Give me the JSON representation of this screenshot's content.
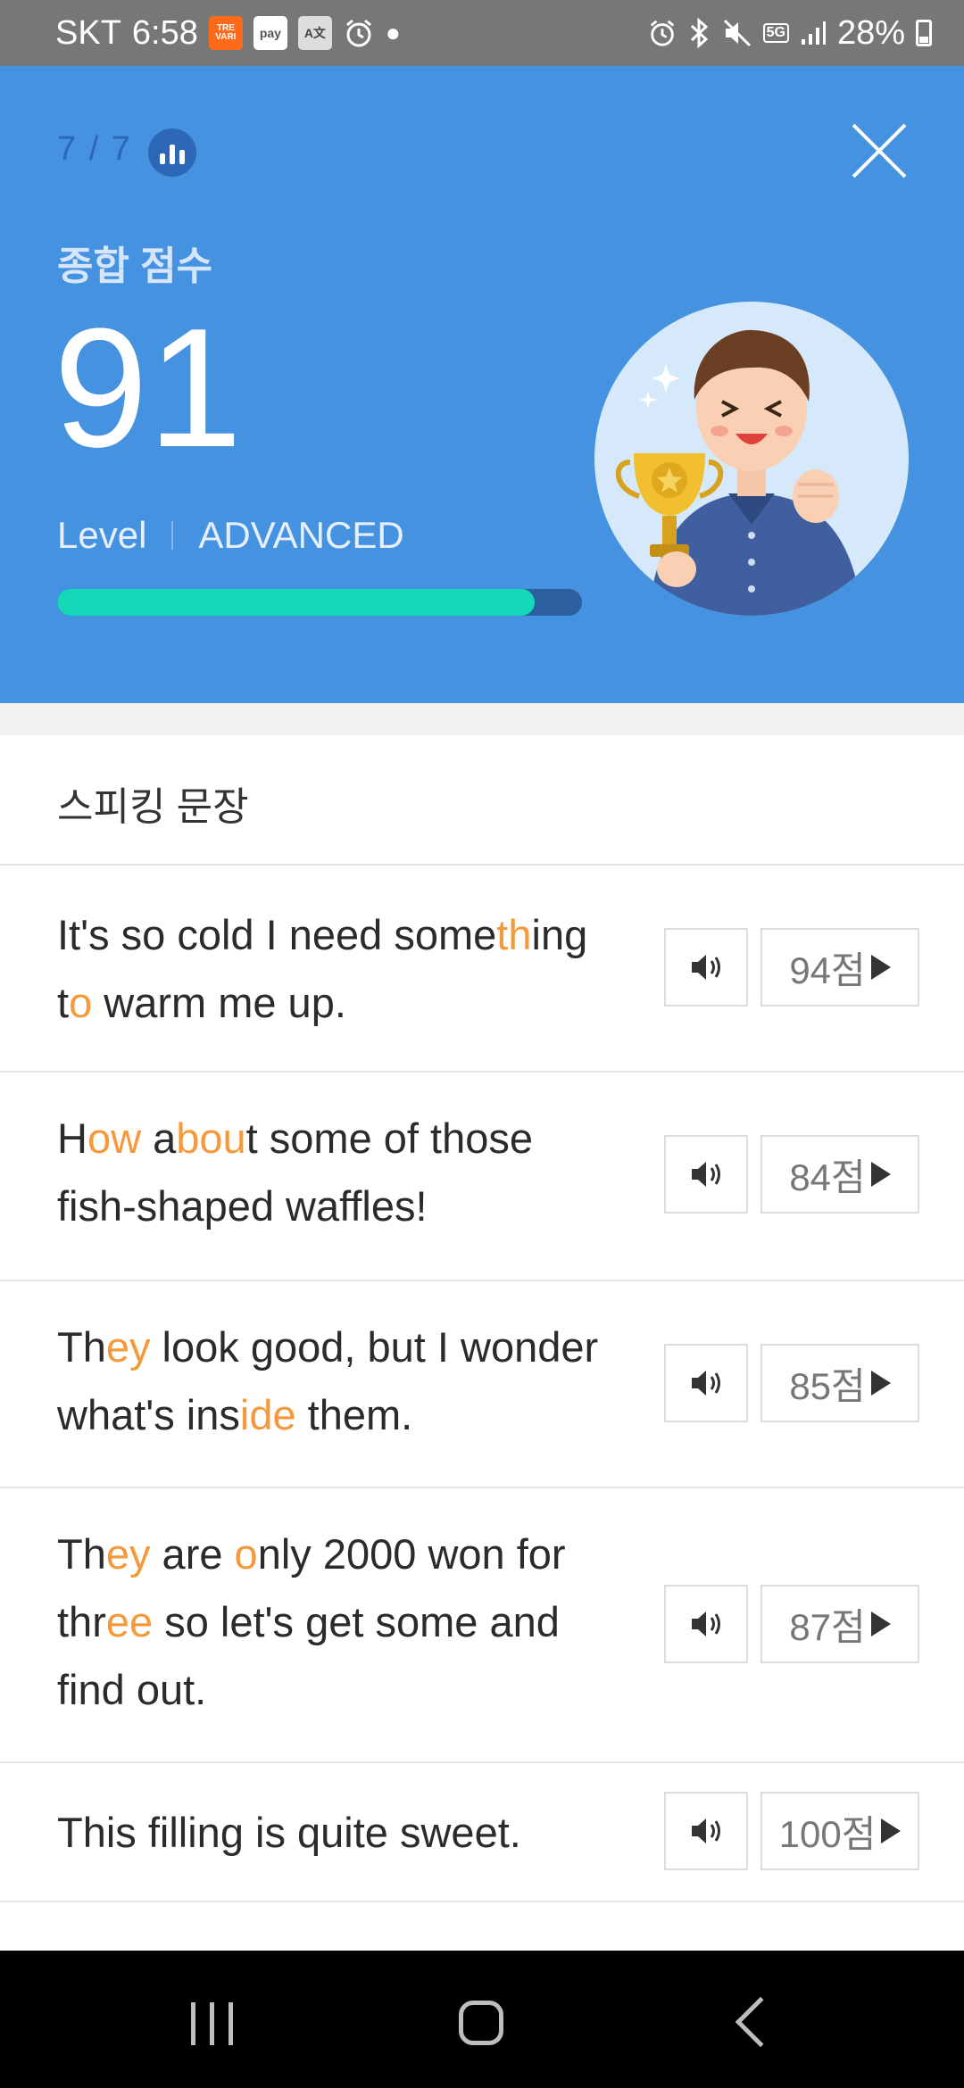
{
  "status_bar": {
    "carrier": "SKT",
    "time": "6:58",
    "app_icons": [
      "TRE VARI",
      "pay",
      "A文"
    ],
    "network": "5G",
    "battery": "28%"
  },
  "header": {
    "progress": "7 / 7",
    "score_label": "종합 점수",
    "score": "91",
    "level_label": "Level",
    "level_value": "ADVANCED",
    "score_bar_fraction": 0.91,
    "colors": {
      "background": "#4592e0",
      "bar_fill": "#14d9b8",
      "bar_track": "#2b5f9f"
    }
  },
  "section": {
    "title": "스피킹 문장"
  },
  "sentences": [
    {
      "segments": [
        {
          "t": "It's so cold I need some",
          "hl": false
        },
        {
          "t": "th",
          "hl": true
        },
        {
          "t": "ing t",
          "hl": false
        },
        {
          "t": "o",
          "hl": true
        },
        {
          "t": " warm me up.",
          "hl": false
        }
      ],
      "score": "94점"
    },
    {
      "segments": [
        {
          "t": "H",
          "hl": false
        },
        {
          "t": "ow",
          "hl": true
        },
        {
          "t": " a",
          "hl": false
        },
        {
          "t": "bou",
          "hl": true
        },
        {
          "t": "t some of those fish-shaped waffles!",
          "hl": false
        }
      ],
      "score": "84점"
    },
    {
      "segments": [
        {
          "t": "Th",
          "hl": false
        },
        {
          "t": "ey",
          "hl": true
        },
        {
          "t": " look good, but I wonder what's ins",
          "hl": false
        },
        {
          "t": "ide",
          "hl": true
        },
        {
          "t": " them.",
          "hl": false
        }
      ],
      "score": "85점"
    },
    {
      "segments": [
        {
          "t": "Th",
          "hl": false
        },
        {
          "t": "ey",
          "hl": true
        },
        {
          "t": " are ",
          "hl": false
        },
        {
          "t": "o",
          "hl": true
        },
        {
          "t": "nly 2000 won for thr",
          "hl": false
        },
        {
          "t": "ee",
          "hl": true
        },
        {
          "t": " so let's get some and find out.",
          "hl": false
        }
      ],
      "score": "87점"
    },
    {
      "segments": [
        {
          "t": "This filling is quite sweet.",
          "hl": false
        }
      ],
      "score": "100점"
    }
  ],
  "icons": {
    "stats": "bar-chart-icon",
    "close": "close-icon",
    "play": "speaker-icon",
    "score_play": "play-triangle-icon",
    "nav_recent": "recent-apps-icon",
    "nav_home": "home-icon",
    "nav_back": "back-icon"
  },
  "highlight_color": "#f59a3c"
}
